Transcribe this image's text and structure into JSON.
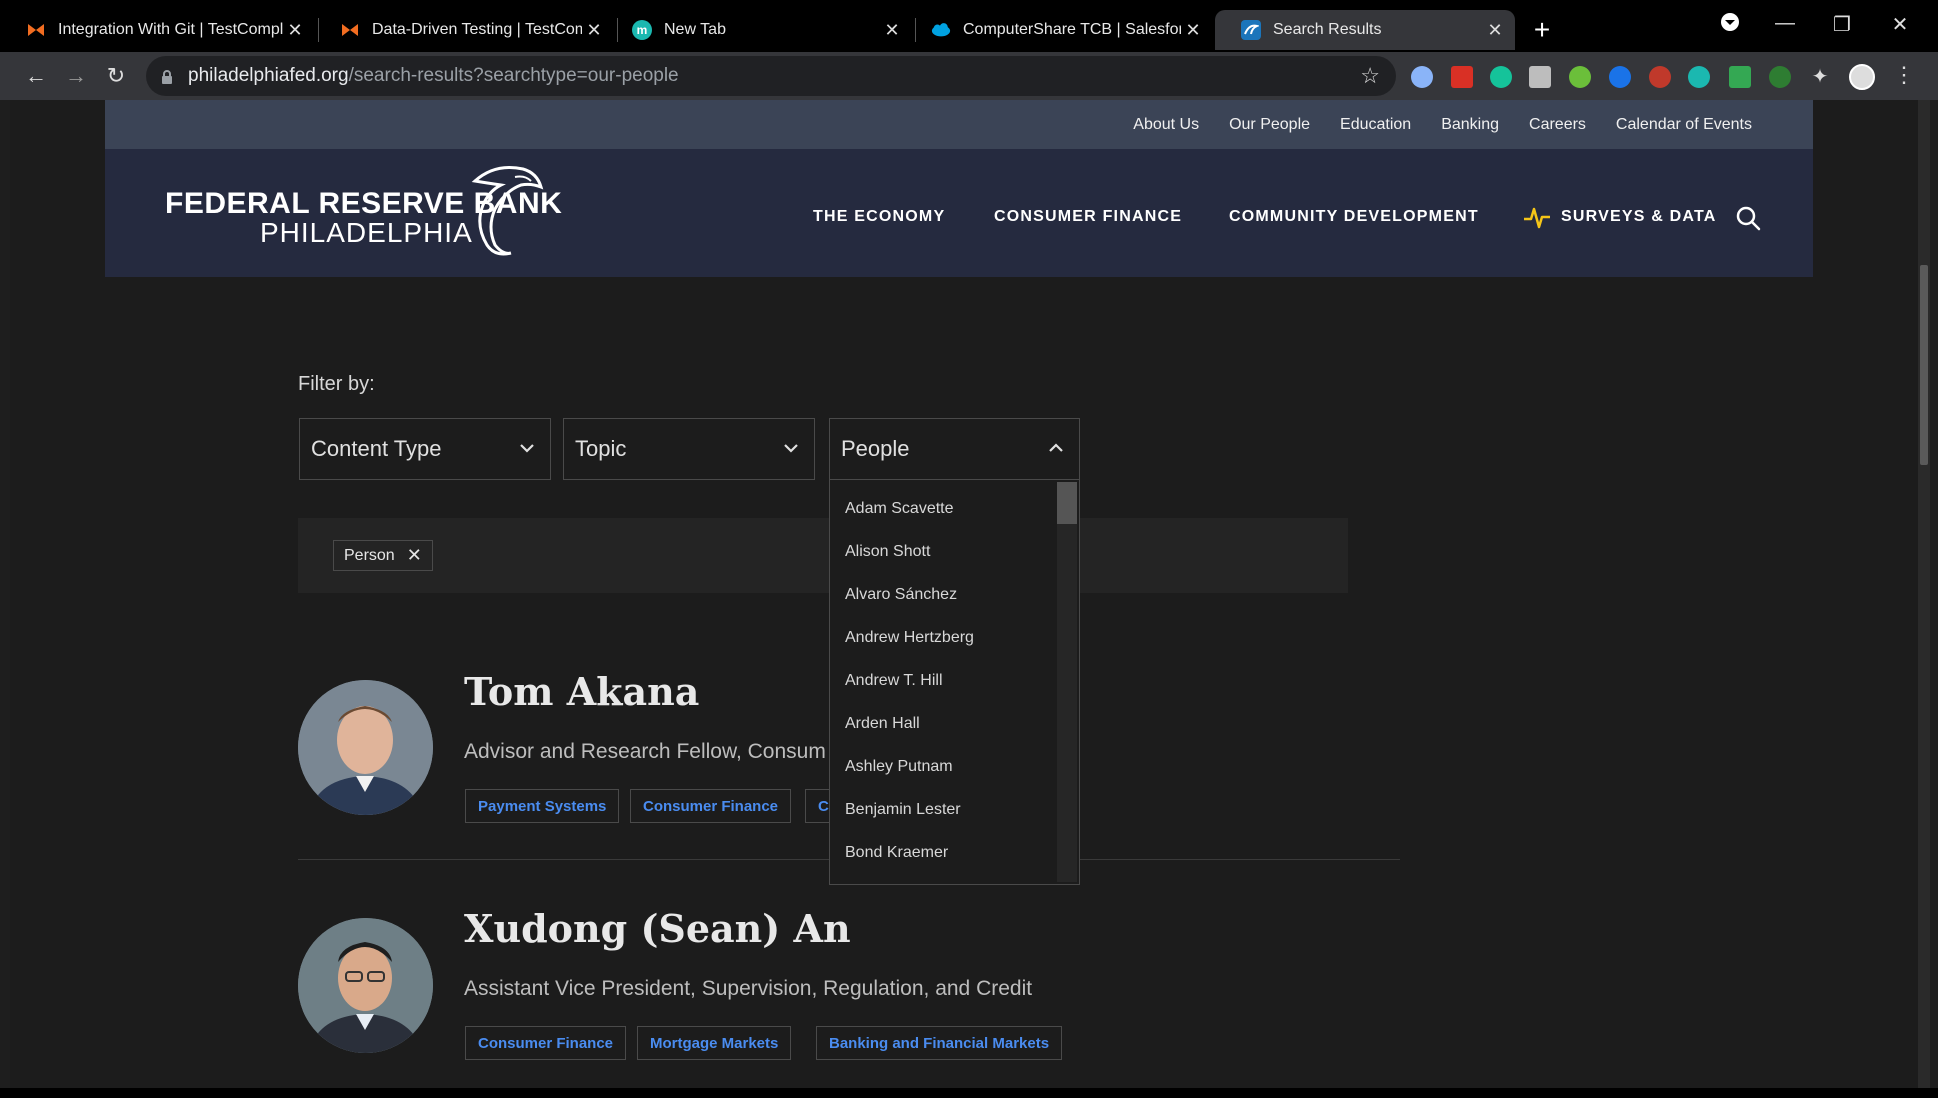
{
  "browser": {
    "tabs": [
      {
        "title": "Integration With Git | TestComple",
        "icon": "testcomplete-icon",
        "color": "#f26d21"
      },
      {
        "title": "Data-Driven Testing | TestComple",
        "icon": "testcomplete-icon",
        "color": "#f26d21"
      },
      {
        "title": "New Tab",
        "icon": "m-icon",
        "color": "#1bb8b0"
      },
      {
        "title": "ComputerShare TCB | Salesforce",
        "icon": "salesforce-icon",
        "color": "#00a1e0"
      },
      {
        "title": "Search Results",
        "icon": "philly-fed-icon",
        "color": "#1b75bb"
      }
    ],
    "url_host": "philadelphiafed.org",
    "url_path": "/search-results?searchtype=our-people"
  },
  "site": {
    "utility_nav": [
      "About Us",
      "Our People",
      "Education",
      "Banking",
      "Careers",
      "Calendar of Events"
    ],
    "logo_line1": "FEDERAL RESERVE BANK",
    "logo_line2": "PHILADELPHIA",
    "main_nav": [
      "THE ECONOMY",
      "CONSUMER FINANCE",
      "COMMUNITY DEVELOPMENT",
      "SURVEYS & DATA"
    ],
    "accent": "#f5c518"
  },
  "filters": {
    "label": "Filter by:",
    "content_type": "Content Type",
    "topic": "Topic",
    "people": "People",
    "active_chip": "Person",
    "people_options": [
      "Adam Scavette",
      "Alison Shott",
      "Alvaro Sánchez",
      "Andrew Hertzberg",
      "Andrew T. Hill",
      "Arden Hall",
      "Ashley Putnam",
      "Benjamin Lester",
      "Bond Kraemer"
    ]
  },
  "results": [
    {
      "name": "Tom Akana",
      "title": "Advisor and Research Fellow, Consum",
      "tags": [
        "Payment Systems",
        "Consumer Finance",
        "C"
      ]
    },
    {
      "name": "Xudong (Sean) An",
      "title": "Assistant Vice President, Supervision, Regulation, and Credit",
      "tags": [
        "Consumer Finance",
        "Mortgage Markets",
        "Banking and Financial Markets"
      ]
    }
  ]
}
